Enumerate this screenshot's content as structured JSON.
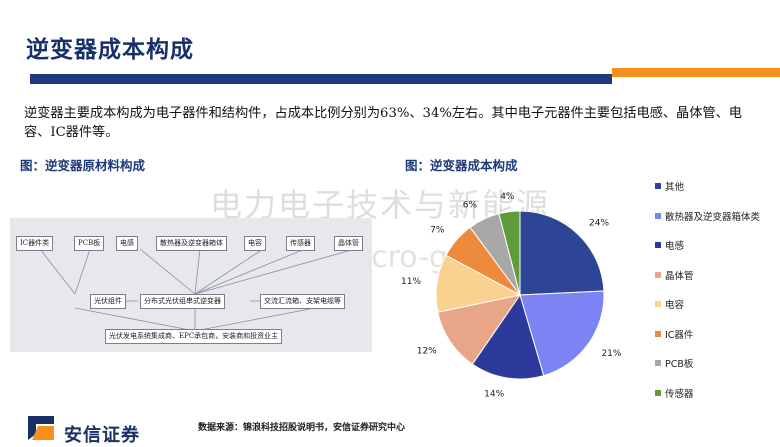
{
  "page_title": "逆变器成本构成",
  "summary_text": "逆变器主要成本构成为电子器件和结构件，占成本比例分别为63%、34%左右。其中电子元器件主要包括电感、晶体管、电容、IC器件等。",
  "watermark": {
    "line1": "电力电子技术与新能源",
    "line2": "www.21micro-grid.cn"
  },
  "left_figure": {
    "title": "图：逆变器原材料构成",
    "top_row": [
      "IC器件类",
      "PCB板",
      "电感",
      "散热器及逆变器箱体",
      "电容",
      "传感器",
      "晶体管"
    ],
    "middle_row": [
      "光伏组件",
      "分布式光伏组串式逆变器",
      "交流汇流箱、支架电缆等"
    ],
    "bottom_row": [
      "光伏发电系统集成商、EPC承包商，安装商和投资业主"
    ]
  },
  "right_figure": {
    "title": "图：逆变器成本构成"
  },
  "chart_data": {
    "type": "pie",
    "title": "图：逆变器成本构成",
    "categories": [
      "其他",
      "散热器及逆变器箱体类",
      "电感",
      "晶体管",
      "电容",
      "IC器件",
      "PCB板",
      "传感器"
    ],
    "values": [
      24,
      21,
      14,
      12,
      11,
      7,
      6,
      4
    ],
    "value_labels": [
      "24%",
      "21%",
      "14%",
      "12%",
      "11%",
      "7%",
      "6%",
      "4%"
    ],
    "colors": [
      "#2e4596",
      "#7b84f2",
      "#2d3a9c",
      "#e9a587",
      "#f8d28e",
      "#ee8a3b",
      "#a8a8a8",
      "#5e9b3c"
    ],
    "legend_position": "right"
  },
  "footer": {
    "logo_text": "安信证券",
    "source_text": "数据来源：锦浪科技招股说明书，安信证券研究中心"
  },
  "colors": {
    "title": "#17306b",
    "navy_bar": "#1f3a7a",
    "orange_bar": "#f5901e"
  }
}
